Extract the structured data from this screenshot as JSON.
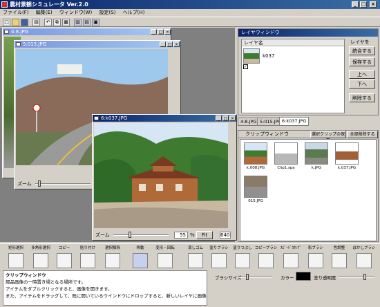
{
  "app": {
    "title": "農村景観シミュレータ Ver.2.0"
  },
  "menu": [
    "ファイル(F)",
    "編集(E)",
    "ウィンドウ(W)",
    "設定(S)",
    "ヘルプ(H)"
  ],
  "windows": {
    "w1": {
      "title": "4:8.JPG"
    },
    "w2": {
      "title": "5:015.JPG"
    },
    "w3": {
      "title": "6:k037.JPG"
    }
  },
  "zoom": {
    "label": "ズーム",
    "value": "55",
    "unit": "%",
    "fit": "Fit",
    "size": "640"
  },
  "layer_panel": {
    "title": "レイヤウィンドウ",
    "name_header": "レイヤ名",
    "layer_name": "k037",
    "group_label": "レイヤを",
    "buttons": [
      "統合する",
      "保存する",
      "上へ",
      "下へ",
      "削除する"
    ]
  },
  "tabs": [
    "4:8.JPG",
    "5:015.JPG",
    "6:k037.JPG"
  ],
  "clip_panel": {
    "title": "クリップウィンドウ",
    "save_btn": "選択クリップの保存",
    "delete_all_btn": "全部削除する",
    "items": [
      "k.008.JPG",
      "Clip1.spa",
      "k.JPG",
      "k.037.JPG",
      "015.JPG"
    ]
  },
  "tools": [
    "矩形選択",
    "多角形選択",
    "コピー",
    "貼り付け",
    "選択解除",
    "移動",
    "変形・回転",
    "消しゴム",
    "塗りブラシ",
    "塗りつぶし",
    "コピーブラシ",
    "ｽﾋﾟｰﾄﾞｽﾀﾝﾌﾟ",
    "影ブラシ",
    "色調整",
    "ぼかしブラシ"
  ],
  "clipinfo": {
    "heading": "クリップウィンドウ",
    "line1": "部品画像の一時置き場となる場所です。",
    "line2": "アイテムをダブルクリックすると、画像を開きます。",
    "line3": "また、アイテムをドラッグして、既に開いているウインドウにドロップすると、新しいレイヤに画像を貼"
  },
  "brush": {
    "size_label": "ブラシサイズ",
    "color_label": "カラー",
    "opacity_label": "塗り透明度",
    "color": "#000000"
  }
}
